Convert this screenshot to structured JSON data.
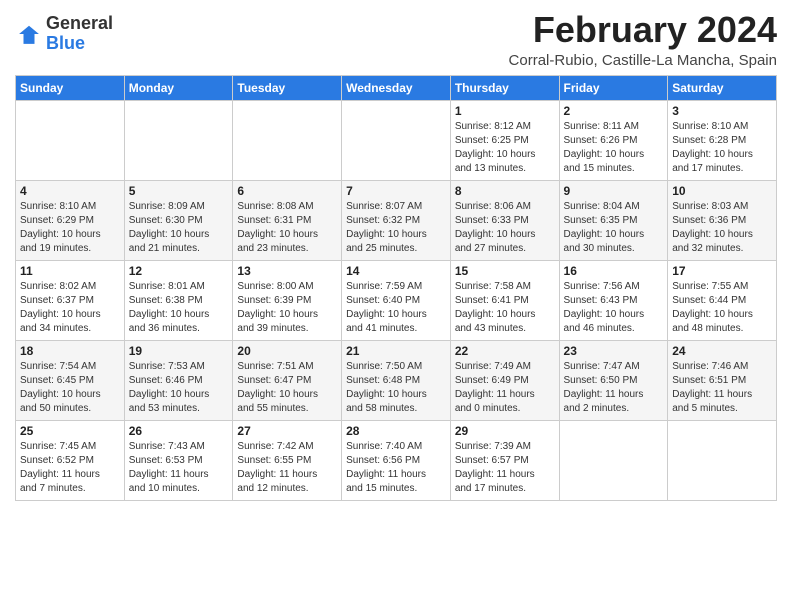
{
  "logo": {
    "general": "General",
    "blue": "Blue"
  },
  "header": {
    "month": "February 2024",
    "location": "Corral-Rubio, Castille-La Mancha, Spain"
  },
  "weekdays": [
    "Sunday",
    "Monday",
    "Tuesday",
    "Wednesday",
    "Thursday",
    "Friday",
    "Saturday"
  ],
  "weeks": [
    [
      {
        "day": "",
        "info": ""
      },
      {
        "day": "",
        "info": ""
      },
      {
        "day": "",
        "info": ""
      },
      {
        "day": "",
        "info": ""
      },
      {
        "day": "1",
        "info": "Sunrise: 8:12 AM\nSunset: 6:25 PM\nDaylight: 10 hours\nand 13 minutes."
      },
      {
        "day": "2",
        "info": "Sunrise: 8:11 AM\nSunset: 6:26 PM\nDaylight: 10 hours\nand 15 minutes."
      },
      {
        "day": "3",
        "info": "Sunrise: 8:10 AM\nSunset: 6:28 PM\nDaylight: 10 hours\nand 17 minutes."
      }
    ],
    [
      {
        "day": "4",
        "info": "Sunrise: 8:10 AM\nSunset: 6:29 PM\nDaylight: 10 hours\nand 19 minutes."
      },
      {
        "day": "5",
        "info": "Sunrise: 8:09 AM\nSunset: 6:30 PM\nDaylight: 10 hours\nand 21 minutes."
      },
      {
        "day": "6",
        "info": "Sunrise: 8:08 AM\nSunset: 6:31 PM\nDaylight: 10 hours\nand 23 minutes."
      },
      {
        "day": "7",
        "info": "Sunrise: 8:07 AM\nSunset: 6:32 PM\nDaylight: 10 hours\nand 25 minutes."
      },
      {
        "day": "8",
        "info": "Sunrise: 8:06 AM\nSunset: 6:33 PM\nDaylight: 10 hours\nand 27 minutes."
      },
      {
        "day": "9",
        "info": "Sunrise: 8:04 AM\nSunset: 6:35 PM\nDaylight: 10 hours\nand 30 minutes."
      },
      {
        "day": "10",
        "info": "Sunrise: 8:03 AM\nSunset: 6:36 PM\nDaylight: 10 hours\nand 32 minutes."
      }
    ],
    [
      {
        "day": "11",
        "info": "Sunrise: 8:02 AM\nSunset: 6:37 PM\nDaylight: 10 hours\nand 34 minutes."
      },
      {
        "day": "12",
        "info": "Sunrise: 8:01 AM\nSunset: 6:38 PM\nDaylight: 10 hours\nand 36 minutes."
      },
      {
        "day": "13",
        "info": "Sunrise: 8:00 AM\nSunset: 6:39 PM\nDaylight: 10 hours\nand 39 minutes."
      },
      {
        "day": "14",
        "info": "Sunrise: 7:59 AM\nSunset: 6:40 PM\nDaylight: 10 hours\nand 41 minutes."
      },
      {
        "day": "15",
        "info": "Sunrise: 7:58 AM\nSunset: 6:41 PM\nDaylight: 10 hours\nand 43 minutes."
      },
      {
        "day": "16",
        "info": "Sunrise: 7:56 AM\nSunset: 6:43 PM\nDaylight: 10 hours\nand 46 minutes."
      },
      {
        "day": "17",
        "info": "Sunrise: 7:55 AM\nSunset: 6:44 PM\nDaylight: 10 hours\nand 48 minutes."
      }
    ],
    [
      {
        "day": "18",
        "info": "Sunrise: 7:54 AM\nSunset: 6:45 PM\nDaylight: 10 hours\nand 50 minutes."
      },
      {
        "day": "19",
        "info": "Sunrise: 7:53 AM\nSunset: 6:46 PM\nDaylight: 10 hours\nand 53 minutes."
      },
      {
        "day": "20",
        "info": "Sunrise: 7:51 AM\nSunset: 6:47 PM\nDaylight: 10 hours\nand 55 minutes."
      },
      {
        "day": "21",
        "info": "Sunrise: 7:50 AM\nSunset: 6:48 PM\nDaylight: 10 hours\nand 58 minutes."
      },
      {
        "day": "22",
        "info": "Sunrise: 7:49 AM\nSunset: 6:49 PM\nDaylight: 11 hours\nand 0 minutes."
      },
      {
        "day": "23",
        "info": "Sunrise: 7:47 AM\nSunset: 6:50 PM\nDaylight: 11 hours\nand 2 minutes."
      },
      {
        "day": "24",
        "info": "Sunrise: 7:46 AM\nSunset: 6:51 PM\nDaylight: 11 hours\nand 5 minutes."
      }
    ],
    [
      {
        "day": "25",
        "info": "Sunrise: 7:45 AM\nSunset: 6:52 PM\nDaylight: 11 hours\nand 7 minutes."
      },
      {
        "day": "26",
        "info": "Sunrise: 7:43 AM\nSunset: 6:53 PM\nDaylight: 11 hours\nand 10 minutes."
      },
      {
        "day": "27",
        "info": "Sunrise: 7:42 AM\nSunset: 6:55 PM\nDaylight: 11 hours\nand 12 minutes."
      },
      {
        "day": "28",
        "info": "Sunrise: 7:40 AM\nSunset: 6:56 PM\nDaylight: 11 hours\nand 15 minutes."
      },
      {
        "day": "29",
        "info": "Sunrise: 7:39 AM\nSunset: 6:57 PM\nDaylight: 11 hours\nand 17 minutes."
      },
      {
        "day": "",
        "info": ""
      },
      {
        "day": "",
        "info": ""
      }
    ]
  ]
}
